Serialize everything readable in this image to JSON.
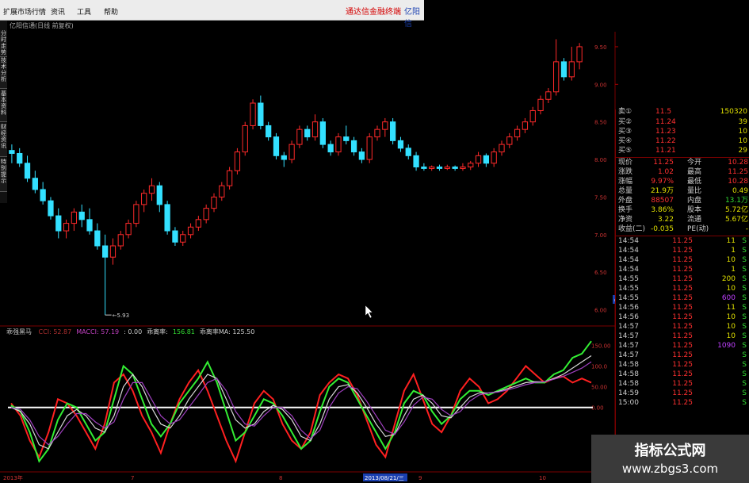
{
  "menu": {
    "items": [
      "扩展市场行情",
      "资讯",
      "工具",
      "帮助"
    ],
    "promo": "通达信金融终端",
    "brand": "亿阳信"
  },
  "chart_title": "亿阳信通(日线 前复权)",
  "left_tabs": [
    "分时走势",
    "技术分析",
    "基本资料",
    "财经资讯",
    "特别提示"
  ],
  "price_chart": {
    "ylim": [
      5.9,
      9.7
    ],
    "yticks": [
      "9.50",
      "9.00",
      "8.50",
      "8.00",
      "7.50",
      "7.00",
      "6.50",
      "6.00"
    ],
    "current_price_tag": "6.09",
    "low_label": "5.93",
    "colors": {
      "up": "#ff2a2a",
      "down": "#33e0ff"
    },
    "candles": [
      [
        8.12,
        8.2,
        7.95,
        8.08
      ],
      [
        8.08,
        8.15,
        7.9,
        7.95
      ],
      [
        7.95,
        8.05,
        7.7,
        7.75
      ],
      [
        7.75,
        7.85,
        7.55,
        7.6
      ],
      [
        7.6,
        7.7,
        7.4,
        7.45
      ],
      [
        7.45,
        7.5,
        7.2,
        7.25
      ],
      [
        7.25,
        7.35,
        6.95,
        7.05
      ],
      [
        7.05,
        7.2,
        6.95,
        7.15
      ],
      [
        7.15,
        7.35,
        7.05,
        7.3
      ],
      [
        7.3,
        7.4,
        7.1,
        7.2
      ],
      [
        7.2,
        7.35,
        7.0,
        7.05
      ],
      [
        7.05,
        7.15,
        6.8,
        6.85
      ],
      [
        6.85,
        7.0,
        5.93,
        6.7
      ],
      [
        6.7,
        6.95,
        6.6,
        6.85
      ],
      [
        6.85,
        7.05,
        6.8,
        7.0
      ],
      [
        7.0,
        7.2,
        6.95,
        7.15
      ],
      [
        7.15,
        7.45,
        7.1,
        7.4
      ],
      [
        7.4,
        7.6,
        7.3,
        7.55
      ],
      [
        7.55,
        7.75,
        7.45,
        7.65
      ],
      [
        7.65,
        7.7,
        7.3,
        7.4
      ],
      [
        7.4,
        7.45,
        7.0,
        7.05
      ],
      [
        7.05,
        7.1,
        6.85,
        6.9
      ],
      [
        6.9,
        7.05,
        6.85,
        7.0
      ],
      [
        7.0,
        7.15,
        6.95,
        7.1
      ],
      [
        7.1,
        7.25,
        7.05,
        7.2
      ],
      [
        7.2,
        7.4,
        7.15,
        7.35
      ],
      [
        7.35,
        7.55,
        7.3,
        7.5
      ],
      [
        7.5,
        7.7,
        7.45,
        7.65
      ],
      [
        7.65,
        7.9,
        7.6,
        7.85
      ],
      [
        7.85,
        8.15,
        7.8,
        8.1
      ],
      [
        8.1,
        8.5,
        8.05,
        8.45
      ],
      [
        8.45,
        8.8,
        8.4,
        8.75
      ],
      [
        8.75,
        8.85,
        8.4,
        8.45
      ],
      [
        8.45,
        8.5,
        8.25,
        8.3
      ],
      [
        8.3,
        8.35,
        8.0,
        8.05
      ],
      [
        8.05,
        8.1,
        7.9,
        8.0
      ],
      [
        8.0,
        8.25,
        7.95,
        8.2
      ],
      [
        8.2,
        8.45,
        8.15,
        8.4
      ],
      [
        8.4,
        8.45,
        8.25,
        8.3
      ],
      [
        8.3,
        8.6,
        8.25,
        8.5
      ],
      [
        8.5,
        8.55,
        8.15,
        8.2
      ],
      [
        8.2,
        8.25,
        8.05,
        8.1
      ],
      [
        8.1,
        8.35,
        8.05,
        8.3
      ],
      [
        8.3,
        8.45,
        8.2,
        8.25
      ],
      [
        8.25,
        8.3,
        8.05,
        8.1
      ],
      [
        8.1,
        8.15,
        7.95,
        8.0
      ],
      [
        8.0,
        8.35,
        7.95,
        8.3
      ],
      [
        8.3,
        8.45,
        8.25,
        8.4
      ],
      [
        8.4,
        8.55,
        8.3,
        8.5
      ],
      [
        8.5,
        8.55,
        8.2,
        8.25
      ],
      [
        8.25,
        8.3,
        8.1,
        8.15
      ],
      [
        8.15,
        8.2,
        8.0,
        8.05
      ],
      [
        8.05,
        8.1,
        7.85,
        7.9
      ],
      [
        7.9,
        7.95,
        7.85,
        7.88
      ],
      [
        7.88,
        7.92,
        7.85,
        7.9
      ],
      [
        7.9,
        7.93,
        7.85,
        7.88
      ],
      [
        7.88,
        7.93,
        7.86,
        7.9
      ],
      [
        7.9,
        7.92,
        7.85,
        7.88
      ],
      [
        7.88,
        7.95,
        7.85,
        7.9
      ],
      [
        7.9,
        7.98,
        7.86,
        7.95
      ],
      [
        7.95,
        8.1,
        7.9,
        8.05
      ],
      [
        8.05,
        8.08,
        7.9,
        7.95
      ],
      [
        7.95,
        8.15,
        7.9,
        8.1
      ],
      [
        8.1,
        8.25,
        8.05,
        8.2
      ],
      [
        8.2,
        8.35,
        8.15,
        8.3
      ],
      [
        8.3,
        8.45,
        8.25,
        8.4
      ],
      [
        8.4,
        8.55,
        8.35,
        8.5
      ],
      [
        8.5,
        8.7,
        8.45,
        8.65
      ],
      [
        8.65,
        8.85,
        8.6,
        8.8
      ],
      [
        8.8,
        8.95,
        8.75,
        8.9
      ],
      [
        8.9,
        9.6,
        8.85,
        9.3
      ],
      [
        9.3,
        9.35,
        9.05,
        9.1
      ],
      [
        9.1,
        9.5,
        9.05,
        9.3
      ],
      [
        9.3,
        9.55,
        9.2,
        9.5
      ]
    ]
  },
  "indicator": {
    "name": "乖强黑马",
    "labels": [
      {
        "text": "CCI: 52.87",
        "color": "#b03030"
      },
      {
        "text": "MACCI: 57.19",
        "color": "#c040c0"
      },
      {
        "text": ": 0.00",
        "color": "#cccccc"
      },
      {
        "text": "乖离率:",
        "color": "#cccccc"
      },
      {
        "text": "156.81",
        "color": "#33dd33"
      },
      {
        "text": "乖离率MA: 125.50",
        "color": "#cccccc"
      }
    ],
    "ylim": [
      -150,
      170
    ],
    "yticks": [
      "150.00",
      "100.0",
      "50.00",
      "0.00"
    ],
    "zero_line": 0,
    "series": [
      {
        "color": "#ff2020",
        "values": [
          10,
          -20,
          -80,
          -120,
          -60,
          20,
          10,
          -20,
          -60,
          -100,
          -40,
          60,
          80,
          40,
          -20,
          -60,
          -110,
          -40,
          20,
          60,
          90,
          40,
          -20,
          -80,
          -130,
          -60,
          10,
          40,
          20,
          -40,
          -80,
          -100,
          -60,
          30,
          60,
          80,
          70,
          30,
          -30,
          -90,
          -120,
          -40,
          40,
          80,
          20,
          -40,
          -60,
          -20,
          40,
          70,
          50,
          10,
          20,
          40,
          70,
          100,
          80,
          60,
          70,
          75,
          60,
          70,
          60
        ]
      },
      {
        "color": "#33ee33",
        "values": [
          5,
          -10,
          -60,
          -130,
          -100,
          -30,
          10,
          0,
          -40,
          -80,
          -60,
          20,
          100,
          80,
          20,
          -40,
          -70,
          -40,
          10,
          40,
          70,
          110,
          60,
          -10,
          -80,
          -60,
          -20,
          20,
          10,
          -20,
          -60,
          -100,
          -80,
          -10,
          50,
          70,
          60,
          20,
          -20,
          -60,
          -100,
          -60,
          10,
          40,
          30,
          -10,
          -40,
          -20,
          20,
          40,
          40,
          30,
          40,
          50,
          60,
          70,
          60,
          60,
          80,
          90,
          120,
          130,
          160
        ]
      },
      {
        "color": "#d8d8d8",
        "values": [
          0,
          -10,
          -40,
          -90,
          -100,
          -60,
          -20,
          -5,
          -20,
          -50,
          -60,
          -20,
          50,
          80,
          50,
          0,
          -40,
          -50,
          -20,
          20,
          50,
          80,
          70,
          20,
          -30,
          -50,
          -40,
          -10,
          5,
          -5,
          -30,
          -70,
          -80,
          -40,
          20,
          50,
          55,
          35,
          0,
          -40,
          -70,
          -65,
          -20,
          20,
          30,
          10,
          -20,
          -25,
          0,
          25,
          35,
          35,
          38,
          45,
          52,
          60,
          62,
          62,
          70,
          80,
          95,
          110,
          125
        ]
      },
      {
        "color": "#a040c0",
        "values": [
          0,
          -5,
          -30,
          -70,
          -90,
          -70,
          -40,
          -15,
          -15,
          -35,
          -50,
          -35,
          20,
          60,
          60,
          20,
          -20,
          -40,
          -30,
          0,
          30,
          60,
          70,
          40,
          -10,
          -40,
          -45,
          -20,
          0,
          0,
          -20,
          -55,
          -75,
          -55,
          0,
          35,
          50,
          45,
          15,
          -20,
          -55,
          -65,
          -35,
          5,
          25,
          20,
          -5,
          -20,
          -10,
          15,
          30,
          35,
          37,
          42,
          48,
          55,
          60,
          62,
          68,
          75,
          85,
          95,
          110
        ]
      }
    ]
  },
  "dates": [
    {
      "text": "2013年",
      "pos": "left"
    },
    {
      "text": "7",
      "pos": "a"
    },
    {
      "text": "8",
      "pos": "b"
    },
    {
      "text": "2013/08/21/三",
      "pos": "c"
    },
    {
      "text": "9",
      "pos": "d"
    },
    {
      "text": "10",
      "pos": "e"
    }
  ],
  "quote_panel": {
    "top_partial": {
      "label": "卖①",
      "price": "11.5",
      "vol": "150320"
    },
    "bids": [
      {
        "label": "买②",
        "price": "11.24",
        "vol": "39"
      },
      {
        "label": "买③",
        "price": "11.23",
        "vol": "10"
      },
      {
        "label": "买④",
        "price": "11.22",
        "vol": "10"
      },
      {
        "label": "买⑤",
        "price": "11.21",
        "vol": "29"
      }
    ],
    "stats": [
      {
        "l1": "现价",
        "v1": "11.25",
        "l2": "今开",
        "v2": "10.28",
        "c1": "#ff3030",
        "c2": "#ff3030"
      },
      {
        "l1": "涨跌",
        "v1": "1.02",
        "l2": "最高",
        "v2": "11.25",
        "c1": "#ff3030",
        "c2": "#ff3030"
      },
      {
        "l1": "涨幅",
        "v1": "9.97%",
        "l2": "最低",
        "v2": "10.28",
        "c1": "#ff3030",
        "c2": "#ff3030"
      },
      {
        "l1": "总量",
        "v1": "21.9万",
        "l2": "量比",
        "v2": "0.49",
        "c1": "#e0e000",
        "c2": "#e0e000"
      },
      {
        "l1": "外盘",
        "v1": "88507",
        "l2": "内盘",
        "v2": "13.1万",
        "c1": "#ff3030",
        "c2": "#33dd33"
      },
      {
        "l1": "换手",
        "v1": "3.86%",
        "l2": "股本",
        "v2": "5.72亿",
        "c1": "#e0e000",
        "c2": "#e0e000"
      },
      {
        "l1": "净资",
        "v1": "3.22",
        "l2": "流通",
        "v2": "5.67亿",
        "c1": "#e0e000",
        "c2": "#e0e000"
      },
      {
        "l1": "收益(二)",
        "v1": "-0.035",
        "l2": "PE(动)",
        "v2": "-",
        "c1": "#e0e000",
        "c2": "#e0e000"
      }
    ],
    "ticks": [
      {
        "t": "14:54",
        "p": "11.25",
        "v": "11",
        "s": "S",
        "vc": "#e0e000",
        "sc": "#33dd33"
      },
      {
        "t": "14:54",
        "p": "11.25",
        "v": "1",
        "s": "S",
        "vc": "#e0e000",
        "sc": "#33dd33"
      },
      {
        "t": "14:54",
        "p": "11.25",
        "v": "10",
        "s": "S",
        "vc": "#e0e000",
        "sc": "#33dd33"
      },
      {
        "t": "14:54",
        "p": "11.25",
        "v": "1",
        "s": "S",
        "vc": "#e0e000",
        "sc": "#33dd33"
      },
      {
        "t": "14:55",
        "p": "11.25",
        "v": "200",
        "s": "S",
        "vc": "#e0e000",
        "sc": "#33dd33"
      },
      {
        "t": "14:55",
        "p": "11.25",
        "v": "10",
        "s": "S",
        "vc": "#e0e000",
        "sc": "#33dd33"
      },
      {
        "t": "14:55",
        "p": "11.25",
        "v": "600",
        "s": "S",
        "vc": "#c040ff",
        "sc": "#33dd33"
      },
      {
        "t": "14:56",
        "p": "11.25",
        "v": "11",
        "s": "S",
        "vc": "#e0e000",
        "sc": "#33dd33"
      },
      {
        "t": "14:56",
        "p": "11.25",
        "v": "10",
        "s": "S",
        "vc": "#e0e000",
        "sc": "#33dd33"
      },
      {
        "t": "14:57",
        "p": "11.25",
        "v": "10",
        "s": "S",
        "vc": "#e0e000",
        "sc": "#33dd33"
      },
      {
        "t": "14:57",
        "p": "11.25",
        "v": "10",
        "s": "S",
        "vc": "#e0e000",
        "sc": "#33dd33"
      },
      {
        "t": "14:57",
        "p": "11.25",
        "v": "1090",
        "s": "S",
        "vc": "#c040ff",
        "sc": "#33dd33"
      },
      {
        "t": "14:57",
        "p": "11.25",
        "v": "",
        "s": "S",
        "vc": "#e0e000",
        "sc": "#33dd33"
      },
      {
        "t": "14:58",
        "p": "11.25",
        "v": "",
        "s": "S",
        "vc": "#e0e000",
        "sc": "#33dd33"
      },
      {
        "t": "14:58",
        "p": "11.25",
        "v": "",
        "s": "S",
        "vc": "#e0e000",
        "sc": "#33dd33"
      },
      {
        "t": "14:58",
        "p": "11.25",
        "v": "",
        "s": "S",
        "vc": "#e0e000",
        "sc": "#33dd33"
      },
      {
        "t": "14:59",
        "p": "11.25",
        "v": "",
        "s": "S",
        "vc": "#e0e000",
        "sc": "#33dd33"
      },
      {
        "t": "15:00",
        "p": "11.25",
        "v": "",
        "s": "S",
        "vc": "#e0e000",
        "sc": "#33dd33"
      }
    ]
  },
  "watermark": {
    "line1": "指标公式网",
    "line2": "www.zbgs3.com"
  }
}
